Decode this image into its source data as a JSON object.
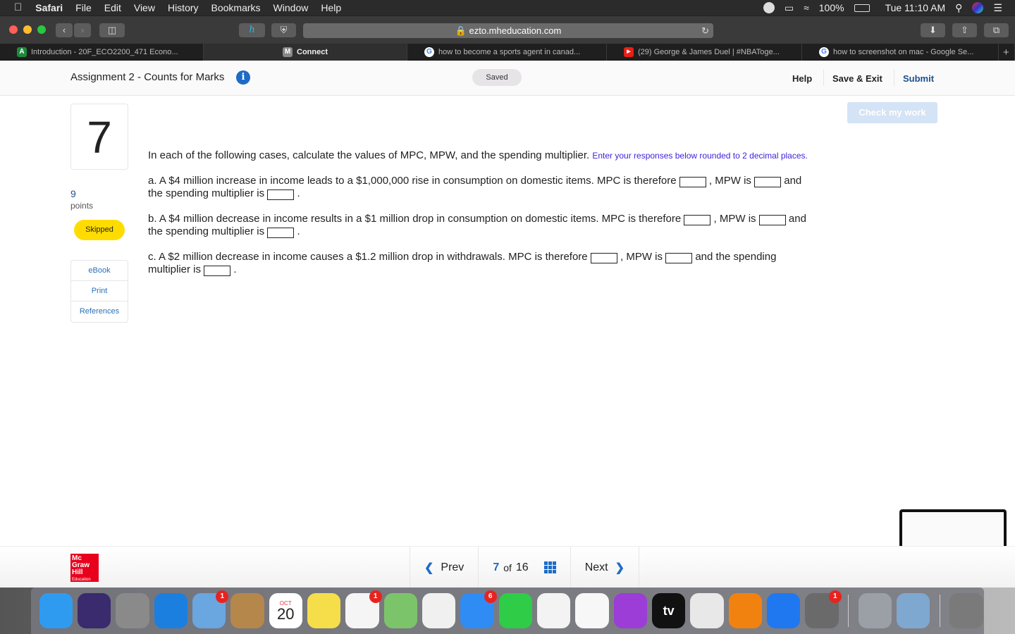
{
  "menubar": {
    "app_name": "Safari",
    "items": [
      "File",
      "Edit",
      "View",
      "History",
      "Bookmarks",
      "Window",
      "Help"
    ],
    "battery": "100%",
    "clock": "Tue 11:10 AM"
  },
  "toolbar": {
    "url": "ezto.mheducation.com"
  },
  "tabs": [
    {
      "label": "Introduction - 20F_ECO2200_471 Econo...",
      "icon": "ac-favicon",
      "color": "#1e8a3c"
    },
    {
      "label": "Connect",
      "icon": "m-favicon",
      "color": "#888888"
    },
    {
      "label": "how to become a sports agent in canad...",
      "icon": "google-favicon",
      "color": "#4285f4"
    },
    {
      "label": "(29) George & James Duel | #NBATogе...",
      "icon": "youtube-favicon",
      "color": "#e62117"
    },
    {
      "label": "how to screenshot on mac - Google Se...",
      "icon": "google-favicon",
      "color": "#4285f4"
    }
  ],
  "header": {
    "title": "Assignment 2 - Counts for Marks",
    "saved": "Saved",
    "help": "Help",
    "save_exit": "Save & Exit",
    "submit": "Submit"
  },
  "check_my_work": "Check my work",
  "question": {
    "number": "7",
    "points": "9",
    "points_label": "points",
    "status": "Skipped",
    "resources": [
      "eBook",
      "Print",
      "References"
    ],
    "intro": "In each of the following cases, calculate the values of MPC, MPW, and the spending multiplier.",
    "hint": "Enter your responses below rounded to 2 decimal places.",
    "parts": {
      "a": {
        "text1": "a. A $4 million increase in income leads to a $1,000,000 rise in consumption on domestic items. MPC is therefore",
        "text2": ", MPW is",
        "text3": "and the spending multiplier is",
        "text4": ".",
        "mpc": "",
        "mpw": "",
        "multiplier": ""
      },
      "b": {
        "text1": "b. A $4 million decrease in income results in a $1 million drop in consumption on domestic items. MPC is therefore",
        "text2": ", MPW is",
        "text3": "and the spending multiplier is",
        "text4": ".",
        "mpc": "",
        "mpw": "",
        "multiplier": ""
      },
      "c": {
        "text1": "c. A $2 million decrease in income causes a $1.2 million drop in withdrawals. MPC is therefore",
        "text2": ", MPW is",
        "text3": "and the spending multiplier is",
        "text4": ".",
        "mpc": "",
        "mpw": "",
        "multiplier": ""
      }
    }
  },
  "footer": {
    "logo_lines": [
      "Mc",
      "Graw",
      "Hill",
      "Education"
    ],
    "prev": "Prev",
    "current": "7",
    "of": "of",
    "total": "16",
    "next": "Next"
  },
  "dock": {
    "apps": [
      {
        "name": "Finder",
        "color": "#2f9bf0",
        "badge": ""
      },
      {
        "name": "Siri",
        "color": "#3a2a6e",
        "badge": ""
      },
      {
        "name": "Launchpad",
        "color": "#8a8a8a",
        "badge": ""
      },
      {
        "name": "Safari",
        "color": "#1b7fe0",
        "badge": ""
      },
      {
        "name": "Mail",
        "color": "#6aa6e0",
        "badge": "1"
      },
      {
        "name": "Contacts",
        "color": "#b5874a",
        "badge": ""
      },
      {
        "name": "Calendar",
        "color": "#ffffff",
        "badge": "",
        "text": "20",
        "month": "OCT"
      },
      {
        "name": "Notes",
        "color": "#f5de4a",
        "badge": ""
      },
      {
        "name": "Reminders",
        "color": "#f5f5f5",
        "badge": "1"
      },
      {
        "name": "Maps",
        "color": "#7cc46a",
        "badge": ""
      },
      {
        "name": "Photos",
        "color": "#f0f0f0",
        "badge": ""
      },
      {
        "name": "Messages",
        "color": "#2f8cf5",
        "badge": "6"
      },
      {
        "name": "FaceTime",
        "color": "#2ecc47",
        "badge": ""
      },
      {
        "name": "News",
        "color": "#f3f3f3",
        "badge": ""
      },
      {
        "name": "Music",
        "color": "#f7f7f7",
        "badge": ""
      },
      {
        "name": "Podcasts",
        "color": "#9b3dd6",
        "badge": ""
      },
      {
        "name": "TV",
        "color": "#111111",
        "badge": "",
        "text": "tv"
      },
      {
        "name": "Numbers",
        "color": "#e8e8e8",
        "badge": ""
      },
      {
        "name": "Books",
        "color": "#f2820f",
        "badge": ""
      },
      {
        "name": "App Store",
        "color": "#1f78f0",
        "badge": ""
      },
      {
        "name": "System Preferences",
        "color": "#6a6a6a",
        "badge": "1"
      }
    ],
    "utilities": [
      {
        "name": "Keychain Access",
        "color": "#9aa0a6"
      },
      {
        "name": "Preview",
        "color": "#7fa8d0"
      }
    ],
    "trash": {
      "name": "Trash",
      "color": "#7a7a7a"
    }
  }
}
